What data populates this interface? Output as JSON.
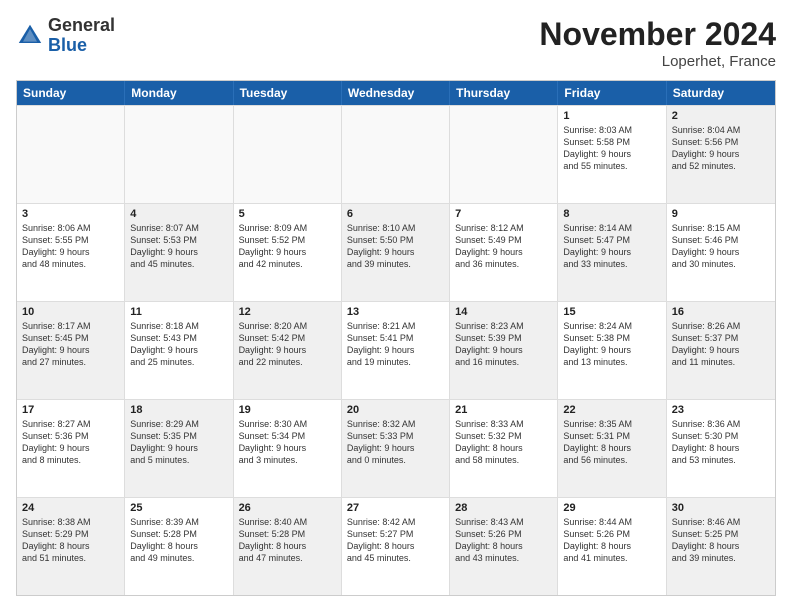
{
  "header": {
    "logo_general": "General",
    "logo_blue": "Blue",
    "month_title": "November 2024",
    "location": "Loperhet, France"
  },
  "days_of_week": [
    "Sunday",
    "Monday",
    "Tuesday",
    "Wednesday",
    "Thursday",
    "Friday",
    "Saturday"
  ],
  "rows": [
    {
      "cells": [
        {
          "empty": true
        },
        {
          "empty": true
        },
        {
          "empty": true
        },
        {
          "empty": true
        },
        {
          "empty": true
        },
        {
          "day": 1,
          "info": "Sunrise: 8:03 AM\nSunset: 5:58 PM\nDaylight: 9 hours\nand 55 minutes.",
          "shaded": false
        },
        {
          "day": 2,
          "info": "Sunrise: 8:04 AM\nSunset: 5:56 PM\nDaylight: 9 hours\nand 52 minutes.",
          "shaded": true
        }
      ]
    },
    {
      "cells": [
        {
          "day": 3,
          "info": "Sunrise: 8:06 AM\nSunset: 5:55 PM\nDaylight: 9 hours\nand 48 minutes.",
          "shaded": false
        },
        {
          "day": 4,
          "info": "Sunrise: 8:07 AM\nSunset: 5:53 PM\nDaylight: 9 hours\nand 45 minutes.",
          "shaded": true
        },
        {
          "day": 5,
          "info": "Sunrise: 8:09 AM\nSunset: 5:52 PM\nDaylight: 9 hours\nand 42 minutes.",
          "shaded": false
        },
        {
          "day": 6,
          "info": "Sunrise: 8:10 AM\nSunset: 5:50 PM\nDaylight: 9 hours\nand 39 minutes.",
          "shaded": true
        },
        {
          "day": 7,
          "info": "Sunrise: 8:12 AM\nSunset: 5:49 PM\nDaylight: 9 hours\nand 36 minutes.",
          "shaded": false
        },
        {
          "day": 8,
          "info": "Sunrise: 8:14 AM\nSunset: 5:47 PM\nDaylight: 9 hours\nand 33 minutes.",
          "shaded": true
        },
        {
          "day": 9,
          "info": "Sunrise: 8:15 AM\nSunset: 5:46 PM\nDaylight: 9 hours\nand 30 minutes.",
          "shaded": false
        }
      ]
    },
    {
      "cells": [
        {
          "day": 10,
          "info": "Sunrise: 8:17 AM\nSunset: 5:45 PM\nDaylight: 9 hours\nand 27 minutes.",
          "shaded": true
        },
        {
          "day": 11,
          "info": "Sunrise: 8:18 AM\nSunset: 5:43 PM\nDaylight: 9 hours\nand 25 minutes.",
          "shaded": false
        },
        {
          "day": 12,
          "info": "Sunrise: 8:20 AM\nSunset: 5:42 PM\nDaylight: 9 hours\nand 22 minutes.",
          "shaded": true
        },
        {
          "day": 13,
          "info": "Sunrise: 8:21 AM\nSunset: 5:41 PM\nDaylight: 9 hours\nand 19 minutes.",
          "shaded": false
        },
        {
          "day": 14,
          "info": "Sunrise: 8:23 AM\nSunset: 5:39 PM\nDaylight: 9 hours\nand 16 minutes.",
          "shaded": true
        },
        {
          "day": 15,
          "info": "Sunrise: 8:24 AM\nSunset: 5:38 PM\nDaylight: 9 hours\nand 13 minutes.",
          "shaded": false
        },
        {
          "day": 16,
          "info": "Sunrise: 8:26 AM\nSunset: 5:37 PM\nDaylight: 9 hours\nand 11 minutes.",
          "shaded": true
        }
      ]
    },
    {
      "cells": [
        {
          "day": 17,
          "info": "Sunrise: 8:27 AM\nSunset: 5:36 PM\nDaylight: 9 hours\nand 8 minutes.",
          "shaded": false
        },
        {
          "day": 18,
          "info": "Sunrise: 8:29 AM\nSunset: 5:35 PM\nDaylight: 9 hours\nand 5 minutes.",
          "shaded": true
        },
        {
          "day": 19,
          "info": "Sunrise: 8:30 AM\nSunset: 5:34 PM\nDaylight: 9 hours\nand 3 minutes.",
          "shaded": false
        },
        {
          "day": 20,
          "info": "Sunrise: 8:32 AM\nSunset: 5:33 PM\nDaylight: 9 hours\nand 0 minutes.",
          "shaded": true
        },
        {
          "day": 21,
          "info": "Sunrise: 8:33 AM\nSunset: 5:32 PM\nDaylight: 8 hours\nand 58 minutes.",
          "shaded": false
        },
        {
          "day": 22,
          "info": "Sunrise: 8:35 AM\nSunset: 5:31 PM\nDaylight: 8 hours\nand 56 minutes.",
          "shaded": true
        },
        {
          "day": 23,
          "info": "Sunrise: 8:36 AM\nSunset: 5:30 PM\nDaylight: 8 hours\nand 53 minutes.",
          "shaded": false
        }
      ]
    },
    {
      "cells": [
        {
          "day": 24,
          "info": "Sunrise: 8:38 AM\nSunset: 5:29 PM\nDaylight: 8 hours\nand 51 minutes.",
          "shaded": true
        },
        {
          "day": 25,
          "info": "Sunrise: 8:39 AM\nSunset: 5:28 PM\nDaylight: 8 hours\nand 49 minutes.",
          "shaded": false
        },
        {
          "day": 26,
          "info": "Sunrise: 8:40 AM\nSunset: 5:28 PM\nDaylight: 8 hours\nand 47 minutes.",
          "shaded": true
        },
        {
          "day": 27,
          "info": "Sunrise: 8:42 AM\nSunset: 5:27 PM\nDaylight: 8 hours\nand 45 minutes.",
          "shaded": false
        },
        {
          "day": 28,
          "info": "Sunrise: 8:43 AM\nSunset: 5:26 PM\nDaylight: 8 hours\nand 43 minutes.",
          "shaded": true
        },
        {
          "day": 29,
          "info": "Sunrise: 8:44 AM\nSunset: 5:26 PM\nDaylight: 8 hours\nand 41 minutes.",
          "shaded": false
        },
        {
          "day": 30,
          "info": "Sunrise: 8:46 AM\nSunset: 5:25 PM\nDaylight: 8 hours\nand 39 minutes.",
          "shaded": true
        }
      ]
    }
  ]
}
